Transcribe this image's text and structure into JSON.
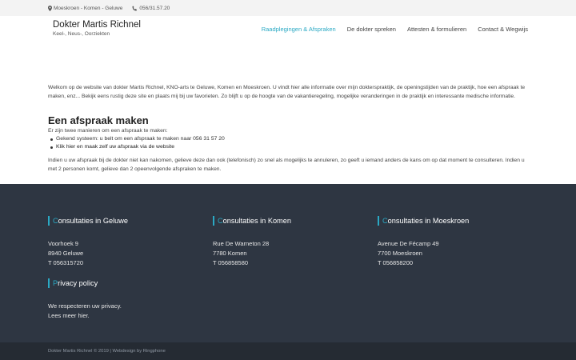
{
  "topbar": {
    "location": "Moeskroen - Komen - Geluwe",
    "phone": "056/31.57.20"
  },
  "brand": {
    "name": "Dokter Martis Richnel",
    "tagline": "Keel-, Neus-, Oorziekten"
  },
  "nav": {
    "items": [
      {
        "label": "Raadplegingen & Afspraken",
        "active": true
      },
      {
        "label": "De dokter spreken",
        "active": false
      },
      {
        "label": "Attesten & formulieren",
        "active": false
      },
      {
        "label": "Contact & Wegwijs",
        "active": false
      }
    ]
  },
  "main": {
    "intro": "Welkom op de website van dokter Martis Richnel, KNO-arts te Geluwe, Komen en Moeskroen. U vindt hier alle informatie over mijn dokterspraktijk, de openingstijden van de praktijk, hoe een afspraak te maken, enz... Bekijk eens rustig deze site en plaats mij bij uw favorieten. Zo blijft u op de hoogte van de vakantieregeling, mogelijke veranderingen in de praktijk en interessante medische informatie.",
    "heading": "Een afspraak maken",
    "subheading": "Er zijn twee manieren om een afspraak te maken:",
    "bullets": [
      "Gekend systeem: u belt om een afspraak te maken naar 056 31 57 20",
      "Klik hier en maak zelf uw afspraak via de website"
    ],
    "note": "Indien u uw afspraak bij de dokter niet kan nakomen, gelieve deze dan ook (telefonisch) zo snel als mogelijks te annuleren, zo geeft u iemand anders de kans om op dat moment te consulteren. Indien u met 2 personen komt, gelieve dan 2 opeenvolgende afspraken te maken."
  },
  "footer": {
    "geluwe": {
      "first": "C",
      "rest": "onsultaties in Geluwe",
      "lines": [
        "Voorhoek 9",
        "8940 Geluwe",
        "T 056315720"
      ]
    },
    "komen": {
      "first": "C",
      "rest": "onsultaties in Komen",
      "lines": [
        "Rue De Warneton 28",
        "7780 Komen",
        "T 056858580"
      ]
    },
    "moeskroen": {
      "first": "C",
      "rest": "onsultaties in Moeskroen",
      "lines": [
        "Avenue De Fécamp 49",
        "7700 Moeskroen",
        "T 056858200"
      ]
    },
    "privacy": {
      "first": "P",
      "rest": "rivacy policy",
      "lines": [
        "We respecteren uw privacy.",
        "Lees meer hier."
      ]
    }
  },
  "bottombar": {
    "text": "Dokter Martis Richnel © 2019 | Webdesign by Ringphone"
  },
  "colors": {
    "accent": "#2aa9c4",
    "footer_bg": "#2e3642",
    "bottombar_bg": "#252b33"
  },
  "icons": {
    "location": "map-marker-icon",
    "phone": "phone-icon"
  }
}
